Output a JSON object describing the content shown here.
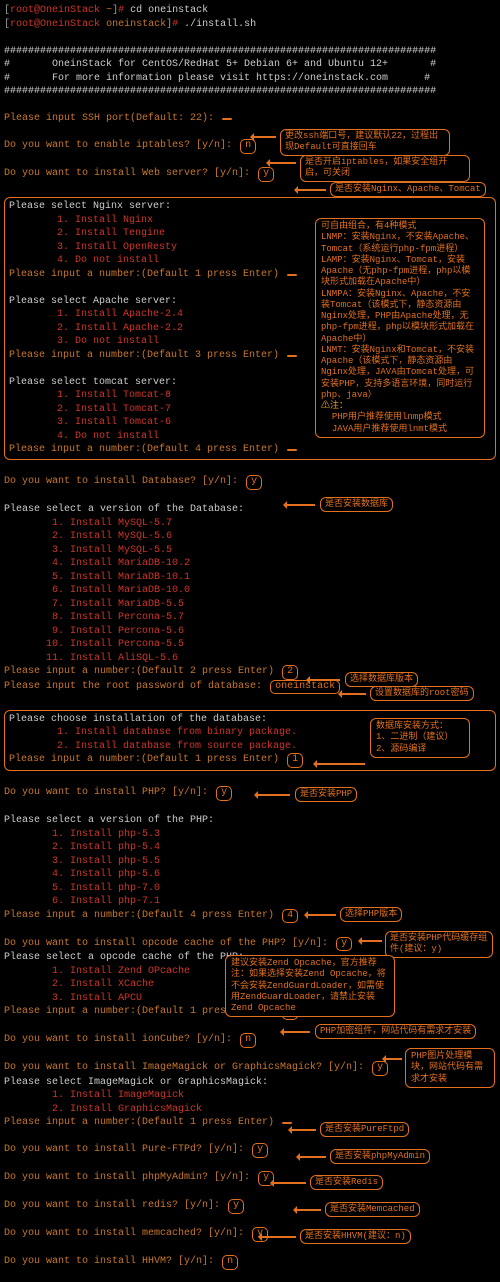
{
  "prompt1": {
    "user": "root",
    "host": "OneinStack",
    "path": "~",
    "cmd": "cd oneinstack"
  },
  "prompt2": {
    "user": "root",
    "host": "OneinStack",
    "path": "oneinstack",
    "cmd": "./install.sh"
  },
  "banner": {
    "rule": "########################################################################",
    "l1": "#       OneinStack for CentOS/RedHat 5+ Debian 6+ and Ubuntu 12+       #",
    "l2": "#       For more information please visit https://oneinstack.com      #"
  },
  "ssh": {
    "q": "Please input SSH port(Default: 22):",
    "bubble": ""
  },
  "ipt": {
    "q": "Do you want to enable iptables? [y/n]:",
    "a": "n",
    "bubble": "是否开启iptables，如果安全组开启，可关闭"
  },
  "web": {
    "q": "Do you want to install Web server? [y/n]:",
    "a": "y",
    "bubble": "是否安装Nginx、Apache、Tomcat"
  },
  "nginx": {
    "head": "Please select Nginx server:",
    "items": [
      "1. Install Nginx",
      "2. Install Tengine",
      "3. Install OpenResty",
      "4. Do not install"
    ],
    "numq": "Please input a number:(Default 1 press Enter)",
    "numv": ""
  },
  "apache": {
    "head": "Please select Apache server:",
    "items": [
      "1. Install Apache-2.4",
      "2. Install Apache-2.2",
      "3. Do not install"
    ],
    "numq": "Please input a number:(Default 3 press Enter)",
    "numv": ""
  },
  "tomcat": {
    "head": "Please select tomcat server:",
    "items": [
      "1. Install Tomcat-8",
      "2. Install Tomcat-7",
      "3. Install Tomcat-6",
      "4. Do not install"
    ],
    "numq": "Please input a number:(Default 4 press Enter)",
    "numv": ""
  },
  "web_bubble": {
    "text": "可自由组合，有4种模式\nLNMP：安装Nginx，不安装Apache、Tomcat（系统运行php-fpm进程）\nLAMP：安装Nginx、Tomcat，安装Apache（无php-fpm进程，php以模块形式加载在Apache中）\nLNMPA：安装Nginx、Apache，不安装Tomcat（该模式下，静态资源由Nginx处理，PHP由Apache处理，无php-fpm进程，php以模块形式加载在Apache中）\nLNMT：安装Nginx和Tomcat，不安装Apache（该模式下，静态资源由Nginx处理，JAVA由Tomcat处理，可安装PHP，支持多语言环境，同时运行php、java）",
    "warn": "⚠注：",
    "note": "  PHP用户推荐使用lnmp模式\n  JAVA用户推荐使用lnmt模式"
  },
  "db": {
    "q": "Do you want to install Database? [y/n]:",
    "a": "y",
    "bubble": "是否安装数据库"
  },
  "dbver": {
    "head": "Please select a version of the Database:",
    "items": [
      "1. Install MySQL-5.7",
      "2. Install MySQL-5.6",
      "3. Install MySQL-5.5",
      "4. Install MariaDB-10.2",
      "5. Install MariaDB-10.1",
      "6. Install MariaDB-10.0",
      "7. Install MariaDB-5.5",
      "8. Install Percona-5.7",
      "9. Install Percona-5.6",
      "10. Install Percona-5.5",
      "11. Install AliSQL-5.6"
    ],
    "numq": "Please input a number:(Default 2 press Enter)",
    "numv": "2",
    "bubble": "选择数据库版本",
    "pwq": "Please input the root password of database:",
    "pwv": "oneinstack",
    "pwbubble": "设置数据库的root密码"
  },
  "dbinst": {
    "head": "Please choose installation of the database:",
    "items": [
      "1. Install database from binary package.",
      "2. Install database from source package."
    ],
    "numq": "Please input a number:(Default 1 press Enter)",
    "numv": "1",
    "bubble": "数据库安装方式：\n1、二进制（建议）\n2、源码编译"
  },
  "php": {
    "q": "Do you want to install PHP? [y/n]:",
    "a": "y",
    "bubble": "是否安装PHP"
  },
  "phpver": {
    "head": "Please select a version of the PHP:",
    "items": [
      "1. Install php-5.3",
      "2. Install php-5.4",
      "3. Install php-5.5",
      "4. Install php-5.6",
      "5. Install php-7.0",
      "6. Install php-7.1"
    ],
    "numq": "Please input a number:(Default 4 press Enter)",
    "numv": "4",
    "bubble": "选择PHP版本"
  },
  "opcache": {
    "q": "Do you want to install opcode cache of the PHP? [y/n]:",
    "a": "y",
    "bubble": "是否安装PHP代码缓存组件(建议：y)"
  },
  "opsel": {
    "head": "Please select a opcode cache of the PHP:",
    "items": [
      "1. Install Zend OPcache",
      "2. Install XCache",
      "3. Install APCU"
    ],
    "numq": "Please input a number:(Default 1 press Enter)",
    "numv": "1",
    "bubble": "建议安装Zend Opcache，官方推荐\n注：如果选择安装Zend Opcache，将不会安装ZendGuardLoader，如需使用ZendGuardLoader，请禁止安装Zend Opcache"
  },
  "ioncube": {
    "q": "Do you want to install ionCube? [y/n]:",
    "a": "n",
    "bubble": "PHP加密组件，网站代码有需求才安装"
  },
  "imagick": {
    "q": "Do you want to install ImageMagick or GraphicsMagick? [y/n]:",
    "a": "y",
    "bubble": "PHP图片处理模块，网站代码有需求才安装",
    "head": "Please select ImageMagick or GraphicsMagick:",
    "items": [
      "1. Install ImageMagick",
      "2. Install GraphicsMagick"
    ],
    "numq": "Please input a number:(Default 1 press Enter)",
    "numv": ""
  },
  "ftpd": {
    "q": "Do you want to install Pure-FTPd? [y/n]:",
    "a": "y",
    "bubble": "是否安装PureFtpd"
  },
  "pma": {
    "q": "Do you want to install phpMyAdmin? [y/n]:",
    "a": "y",
    "bubble": "是否安装phpMyAdmin"
  },
  "redis": {
    "q": "Do you want to install redis? [y/n]:",
    "a": "y",
    "bubble": "是否安装Redis"
  },
  "memc": {
    "q": "Do you want to install memcached? [y/n]:",
    "a": "y",
    "bubble": "是否安装Memcached"
  },
  "hhvm": {
    "q": "Do you want to install HHVM? [y/n]:",
    "a": "n",
    "bubble": "是否安装HHVM(建议：n)"
  },
  "ssh_bubble": "更改ssh端口号，建议默认22，过程出现Default可直接回车"
}
